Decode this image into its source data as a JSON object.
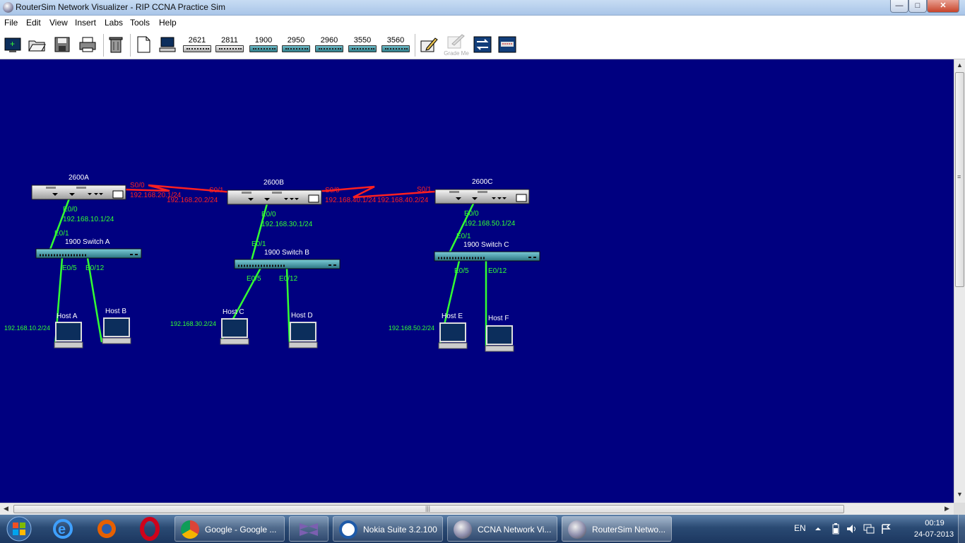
{
  "window": {
    "title": "RouterSim Network Visualizer - RIP CCNA Practice Sim",
    "controls": {
      "minimize": "—",
      "maximize": "□",
      "close": "✕"
    }
  },
  "menu": [
    "File",
    "Edit",
    "View",
    "Insert",
    "Labs",
    "Tools",
    "Help"
  ],
  "toolbar": {
    "file_icons": [
      "new-icon",
      "open-icon",
      "save-icon",
      "print-icon",
      "delete-icon",
      "new-page-icon",
      "computer-icon"
    ],
    "devices": [
      {
        "label": "2621",
        "kind": "router"
      },
      {
        "label": "2811",
        "kind": "router"
      },
      {
        "label": "1900",
        "kind": "switch"
      },
      {
        "label": "2950",
        "kind": "switch"
      },
      {
        "label": "2960",
        "kind": "switch"
      },
      {
        "label": "3550",
        "kind": "switch"
      },
      {
        "label": "3560",
        "kind": "switch"
      }
    ],
    "grade_label": "Grade Me",
    "tool_icons": [
      "pencil-icon",
      "grade-me-icon",
      "switch-config-icon",
      "console-icon"
    ]
  },
  "topology": {
    "colors": {
      "background": "#000080",
      "serial": "#ff2020",
      "ethernet": "#33ff33",
      "device_text": "#ffffff"
    },
    "routers": [
      {
        "name": "2600A",
        "s0": "S0/0",
        "s0_ip": "192.168.20.1/24",
        "e0": "E0/0",
        "e0_ip": "192.168.10.1/24"
      },
      {
        "name": "2600B",
        "s0": "S0/0",
        "s0_ip": "192.168.40.1/24",
        "s1": "S0/1",
        "s1_ip": "192.168.20.2/24",
        "e0": "E0/0",
        "e0_ip": "192.168.30.1/24"
      },
      {
        "name": "2600C",
        "s1": "S0/1",
        "s1_ip": "192.168.40.2/24",
        "e0": "E0/0",
        "e0_ip": "192.168.50.1/24"
      }
    ],
    "switches": [
      {
        "name": "1900 Switch A",
        "up": "E0/1",
        "p1": "E0/5",
        "p2": "E0/12"
      },
      {
        "name": "1900 Switch B",
        "up": "E0/1",
        "p1": "E0/5",
        "p2": "E0/12"
      },
      {
        "name": "1900 Switch C",
        "up": "E0/1",
        "p1": "E0/5",
        "p2": "E0/12"
      }
    ],
    "hosts": [
      {
        "name": "Host A",
        "ip": "192.168.10.2/24"
      },
      {
        "name": "Host B",
        "ip": ""
      },
      {
        "name": "Host C",
        "ip": "192.168.30.2/24"
      },
      {
        "name": "Host D",
        "ip": ""
      },
      {
        "name": "Host E",
        "ip": "192.168.50.2/24"
      },
      {
        "name": "Host F",
        "ip": ""
      }
    ]
  },
  "scrollbar": {
    "grip": "|||",
    "up": "▲",
    "down": "▼",
    "left": "◀",
    "right": "▶",
    "vgrip": "≡"
  },
  "taskbar": {
    "pinned": [
      "ie-icon",
      "firefox-icon",
      "opera-icon"
    ],
    "tasks": [
      {
        "label": "Google - Google ...",
        "icon": "chrome-icon"
      },
      {
        "label": "",
        "icon": "visual-studio-icon"
      },
      {
        "label": "Nokia Suite 3.2.100",
        "icon": "nokia-suite-icon"
      },
      {
        "label": "CCNA Network Vi...",
        "icon": "ccna-visualizer-icon"
      },
      {
        "label": "RouterSim Netwo...",
        "icon": "routersim-icon"
      }
    ],
    "tray": {
      "language": "EN",
      "time": "00:19",
      "date": "24-07-2013"
    }
  }
}
